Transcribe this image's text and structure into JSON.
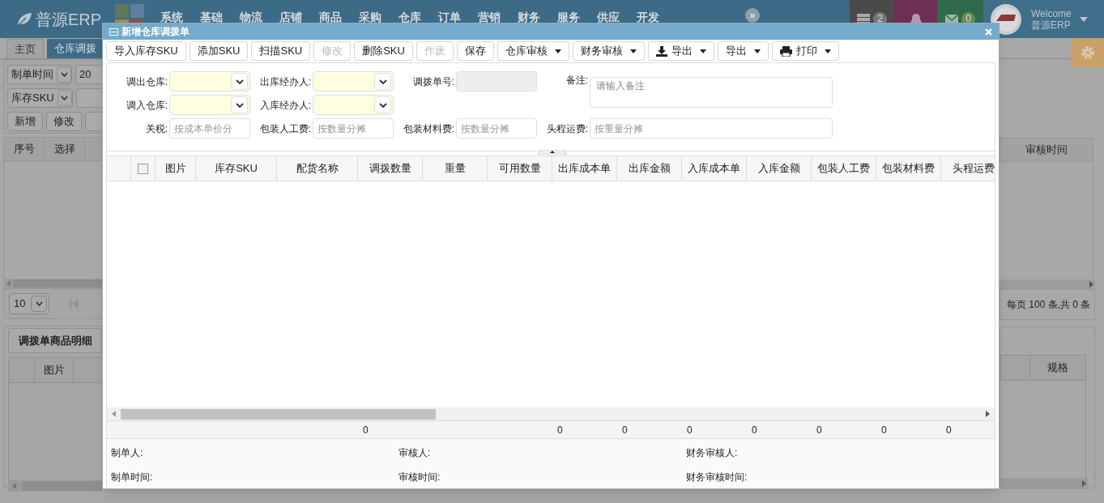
{
  "app": {
    "logo": "普源ERP",
    "nav": [
      "系统",
      "基础",
      "物流",
      "店铺",
      "商品",
      "采购",
      "仓库",
      "订单",
      "营销",
      "财务",
      "服务",
      "供应",
      "开发"
    ],
    "more": "»",
    "notifications": [
      {
        "kind": "tasks",
        "count": "2"
      },
      {
        "kind": "alerts"
      },
      {
        "kind": "messages",
        "count": "0"
      }
    ],
    "user": {
      "greeting": "Welcome",
      "name": "普源ERP"
    }
  },
  "page_tabs": [
    {
      "label": "主页",
      "selected": false
    },
    {
      "label": "仓库调拨",
      "selected": true
    }
  ],
  "list_page": {
    "filters": [
      {
        "kind": "select",
        "value": "制单时间"
      },
      {
        "kind": "input",
        "value": "20"
      },
      {
        "kind": "select",
        "value": "库存SKU"
      },
      {
        "kind": "input"
      }
    ],
    "buttons": [
      "新增",
      "修改"
    ],
    "columns_left": [
      "序号",
      "选择"
    ],
    "columns_right": [
      "审核时间"
    ],
    "page_size": "10",
    "page_summary": "每页 100 条,共 0 条",
    "detail_tab": "调拨单商品明细",
    "detail_columns_left": [
      "图片"
    ],
    "detail_columns_right": [
      "规格"
    ]
  },
  "dialog": {
    "title": "新增仓库调拨单",
    "toolbar": [
      {
        "label": "导入库存SKU",
        "kind": "plain",
        "disabled": false
      },
      {
        "label": "添加SKU",
        "kind": "plain",
        "disabled": false
      },
      {
        "label": "扫描SKU",
        "kind": "plain",
        "disabled": false
      },
      {
        "label": "修改",
        "kind": "plain",
        "disabled": true
      },
      {
        "label": "删除SKU",
        "kind": "plain",
        "disabled": false
      },
      {
        "label": "作废",
        "kind": "plain",
        "disabled": true
      },
      {
        "label": "保存",
        "kind": "plain",
        "disabled": false
      },
      {
        "label": "仓库审核",
        "kind": "plain",
        "disabled": false,
        "dropdown": true
      },
      {
        "label": "财务审核",
        "kind": "plain",
        "disabled": false,
        "dropdown": true
      },
      {
        "label": "导出",
        "kind": "download",
        "disabled": false,
        "dropdown": true
      },
      {
        "label": "导出",
        "kind": "plain",
        "disabled": false,
        "dropdown": true
      },
      {
        "label": "打印",
        "kind": "print",
        "disabled": false,
        "dropdown": true
      }
    ],
    "form": [
      [
        {
          "label": "调出仓库:",
          "kind": "select"
        },
        {
          "label": "出库经办人:",
          "kind": "select"
        },
        {
          "label": "调拨单号:",
          "kind": "readonly"
        },
        {
          "label": "备注:",
          "kind": "textarea",
          "placeholder": "请输入备注"
        }
      ],
      [
        {
          "label": "调入仓库:",
          "kind": "select"
        },
        {
          "label": "入库经办人:",
          "kind": "select"
        }
      ],
      [
        {
          "label": "关税:",
          "kind": "input",
          "placeholder": "按成本单价分"
        },
        {
          "label": "包装人工费:",
          "kind": "input",
          "placeholder": "按数量分摊"
        },
        {
          "label": "包装材料费:",
          "kind": "input",
          "placeholder": "按数量分摊"
        },
        {
          "label": "头程运费:",
          "kind": "input",
          "placeholder": "按重量分摊"
        }
      ]
    ],
    "grid": {
      "select_all": false,
      "columns": [
        {
          "label": "图片"
        },
        {
          "label": "库存SKU"
        },
        {
          "label": "配货名称"
        },
        {
          "label": "调拨数量",
          "sum": "0"
        },
        {
          "label": "重量"
        },
        {
          "label": "可用数量"
        },
        {
          "label": "出库成本单",
          "sum": "0"
        },
        {
          "label": "出库金额",
          "sum": "0"
        },
        {
          "label": "入库成本单",
          "sum": "0"
        },
        {
          "label": "入库金额",
          "sum": "0"
        },
        {
          "label": "包装人工费",
          "sum": "0"
        },
        {
          "label": "包装材料费",
          "sum": "0"
        },
        {
          "label": "头程运费",
          "sum": "0"
        }
      ]
    },
    "info": [
      [
        "制单人:",
        "审核人:",
        "财务审核人:"
      ],
      [
        "制单时间:",
        "审核时间:",
        "财务审核时间:"
      ]
    ]
  }
}
